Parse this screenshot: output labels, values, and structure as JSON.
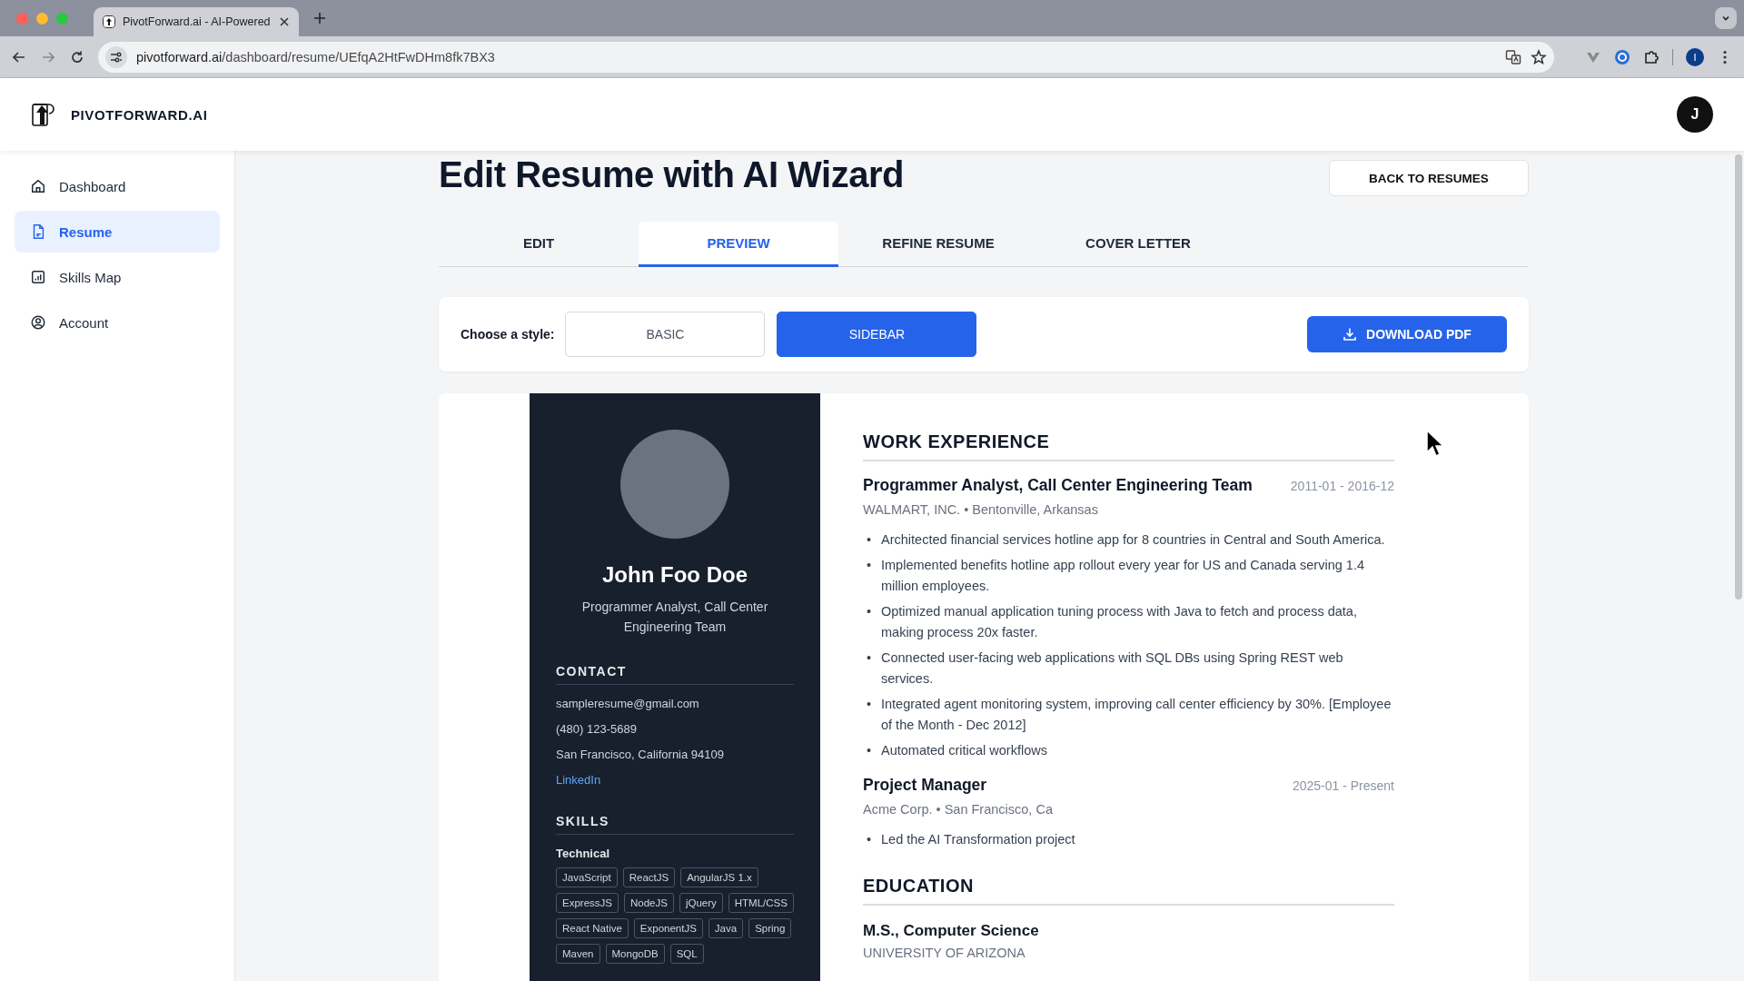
{
  "browser": {
    "tab_title": "PivotForward.ai - AI-Powered",
    "url_host": "pivotforward.ai",
    "url_path": "/dashboard/resume/UEfqA2HtFwDHm8fk7BX3",
    "profile_initial": "I"
  },
  "header": {
    "brand": "PIVOTFORWARD.AI",
    "avatar_initial": "J"
  },
  "sidebar": {
    "items": [
      {
        "label": "Dashboard",
        "selected": false
      },
      {
        "label": "Resume",
        "selected": true
      },
      {
        "label": "Skills Map",
        "selected": false
      },
      {
        "label": "Account",
        "selected": false
      }
    ]
  },
  "page": {
    "title": "Edit Resume with AI Wizard",
    "back_button": "BACK TO RESUMES"
  },
  "tabs": [
    {
      "label": "EDIT",
      "selected": false
    },
    {
      "label": "PREVIEW",
      "selected": true
    },
    {
      "label": "REFINE RESUME",
      "selected": false
    },
    {
      "label": "COVER LETTER",
      "selected": false
    }
  ],
  "style_picker": {
    "label": "Choose a style:",
    "options": [
      {
        "label": "BASIC",
        "selected": false
      },
      {
        "label": "SIDEBAR",
        "selected": true
      }
    ],
    "download_button": "DOWNLOAD PDF"
  },
  "resume": {
    "name": "John Foo Doe",
    "headline": "Programmer Analyst, Call Center Engineering Team",
    "contact": {
      "heading": "CONTACT",
      "items": [
        {
          "kind": "text",
          "text": "sampleresume@gmail.com"
        },
        {
          "kind": "text",
          "text": "(480) 123-5689"
        },
        {
          "kind": "text",
          "text": "San Francisco, California 94109"
        },
        {
          "kind": "link",
          "text": "LinkedIn"
        }
      ]
    },
    "skills": {
      "heading": "SKILLS",
      "groups": [
        {
          "name": "Technical",
          "tags": [
            "JavaScript",
            "ReactJS",
            "AngularJS 1.x",
            "ExpressJS",
            "NodeJS",
            "jQuery",
            "HTML/CSS",
            "React Native",
            "ExponentJS",
            "Java",
            "Spring",
            "Maven",
            "MongoDB",
            "SQL"
          ]
        }
      ]
    },
    "work": {
      "heading": "WORK EXPERIENCE",
      "bullet_marker": "•",
      "jobs": [
        {
          "title": "Programmer Analyst, Call Center Engineering Team",
          "dates": "2011-01 - 2016-12",
          "subtitle": "WALMART, INC. • Bentonville, Arkansas",
          "bullets": [
            "Architected financial services hotline app for 8 countries in Central and South America.",
            "Implemented benefits hotline app rollout every year for US and Canada serving 1.4 million employees.",
            "Optimized manual application tuning process with Java to fetch and process data, making process 20x faster.",
            "Connected user-facing web applications with SQL DBs using Spring REST web services.",
            "Integrated agent monitoring system, improving call center efficiency by 30%. [Employee of the Month - Dec 2012]",
            "Automated critical workflows"
          ]
        },
        {
          "title": "Project Manager",
          "dates": "2025-01 - Present",
          "subtitle": "Acme Corp. • San Francisco, Ca",
          "bullets": [
            "Led the AI Transformation project"
          ]
        }
      ]
    },
    "education": {
      "heading": "EDUCATION",
      "entries": [
        {
          "degree": "M.S., Computer Science",
          "school": "UNIVERSITY OF ARIZONA"
        }
      ]
    }
  }
}
